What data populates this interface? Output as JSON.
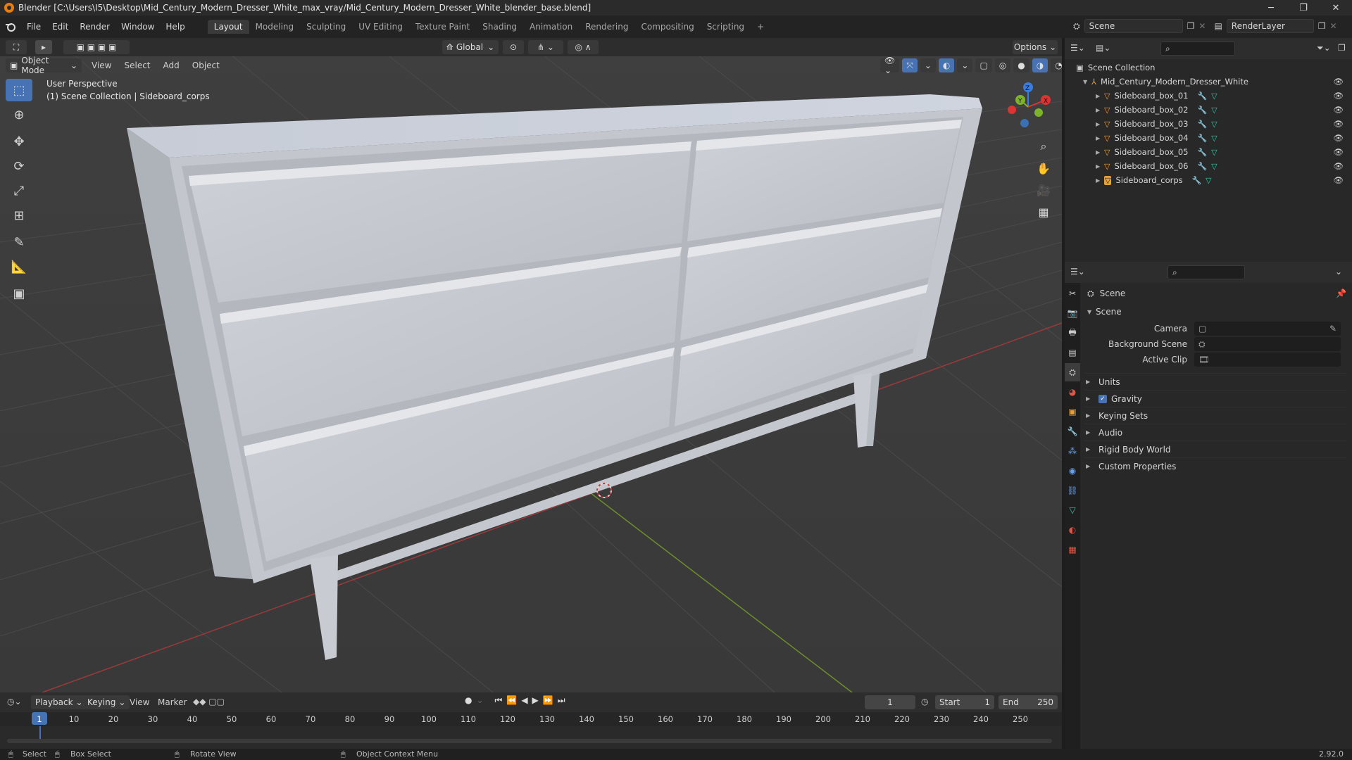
{
  "window": {
    "title": "Blender [C:\\Users\\I5\\Desktop\\Mid_Century_Modern_Dresser_White_max_vray/Mid_Century_Modern_Dresser_White_blender_base.blend]",
    "minimize": "─",
    "maximize": "❐",
    "close": "✕"
  },
  "menu": {
    "items": [
      "File",
      "Edit",
      "Render",
      "Window",
      "Help"
    ]
  },
  "workspaces": [
    "Layout",
    "Modeling",
    "Sculpting",
    "UV Editing",
    "Texture Paint",
    "Shading",
    "Animation",
    "Rendering",
    "Compositing",
    "Scripting"
  ],
  "workspace_add": "+",
  "scene_selector": {
    "value": "Scene"
  },
  "renderlayer_selector": {
    "value": "RenderLayer"
  },
  "viewport_header": {
    "transform_orientation": "Global",
    "options": "Options",
    "mode": "Object Mode",
    "view": "View",
    "select": "Select",
    "add": "Add",
    "object": "Object"
  },
  "viewport_info": {
    "line1": "User Perspective",
    "line2": "(1) Scene Collection | Sideboard_corps"
  },
  "gizmo": {
    "x": "X",
    "y": "Y",
    "z": "Z"
  },
  "outliner": {
    "root": "Scene Collection",
    "collection": "Mid_Century_Modern_Dresser_White",
    "objects": [
      "Sideboard_box_01",
      "Sideboard_box_02",
      "Sideboard_box_03",
      "Sideboard_box_04",
      "Sideboard_box_05",
      "Sideboard_box_06",
      "Sideboard_corps"
    ]
  },
  "properties": {
    "context": "Scene",
    "section": "Scene",
    "camera_label": "Camera",
    "background_scene_label": "Background Scene",
    "active_clip_label": "Active Clip",
    "panels": [
      "Units",
      "Gravity",
      "Keying Sets",
      "Audio",
      "Rigid Body World",
      "Custom Properties"
    ],
    "gravity_checked": true
  },
  "timeline": {
    "playback": "Playback",
    "keying": "Keying",
    "view": "View",
    "marker": "Marker",
    "current_frame": "1",
    "start_label": "Start",
    "start_value": "1",
    "end_label": "End",
    "end_value": "250",
    "ticks": [
      "1",
      "10",
      "20",
      "30",
      "40",
      "50",
      "60",
      "70",
      "80",
      "90",
      "100",
      "110",
      "120",
      "130",
      "140",
      "150",
      "160",
      "170",
      "180",
      "190",
      "200",
      "210",
      "220",
      "230",
      "240",
      "250"
    ]
  },
  "statusbar": {
    "select": "Select",
    "box_select": "Box Select",
    "rotate_view": "Rotate View",
    "context_menu": "Object Context Menu",
    "version": "2.92.0"
  }
}
